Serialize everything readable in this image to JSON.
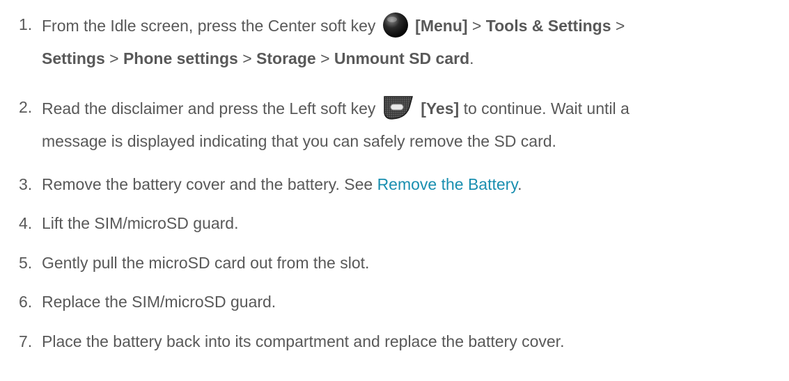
{
  "steps": [
    {
      "number": "1.",
      "line1": {
        "pre": "From the Idle screen, press the Center soft key",
        "key_label": "[Menu]",
        "path1": "Tools & Settings",
        "sep": ">"
      },
      "line2": {
        "items": [
          "Settings",
          "Phone settings",
          "Storage",
          "Unmount SD card"
        ],
        "sep": ">",
        "end": "."
      },
      "icon": "center-soft-key-icon"
    },
    {
      "number": "2.",
      "line1": {
        "pre": "Read the disclaimer and press the Left soft key",
        "key_label": "[Yes]",
        "post": "to continue. Wait until a"
      },
      "line2": "message is displayed indicating that you can safely remove the SD card.",
      "icon": "left-soft-key-icon"
    },
    {
      "number": "3.",
      "pre": "Remove the battery cover and the battery. See ",
      "link": "Remove the Battery",
      "end": "."
    },
    {
      "number": "4.",
      "text": "Lift the SIM/microSD guard."
    },
    {
      "number": "5.",
      "text": "Gently pull the microSD card out from the slot."
    },
    {
      "number": "6.",
      "text": "Replace the SIM/microSD guard."
    },
    {
      "number": "7.",
      "text": "Place the battery back into its compartment and replace the battery cover."
    }
  ],
  "colors": {
    "text": "#595959",
    "link": "#1a8fb0"
  }
}
